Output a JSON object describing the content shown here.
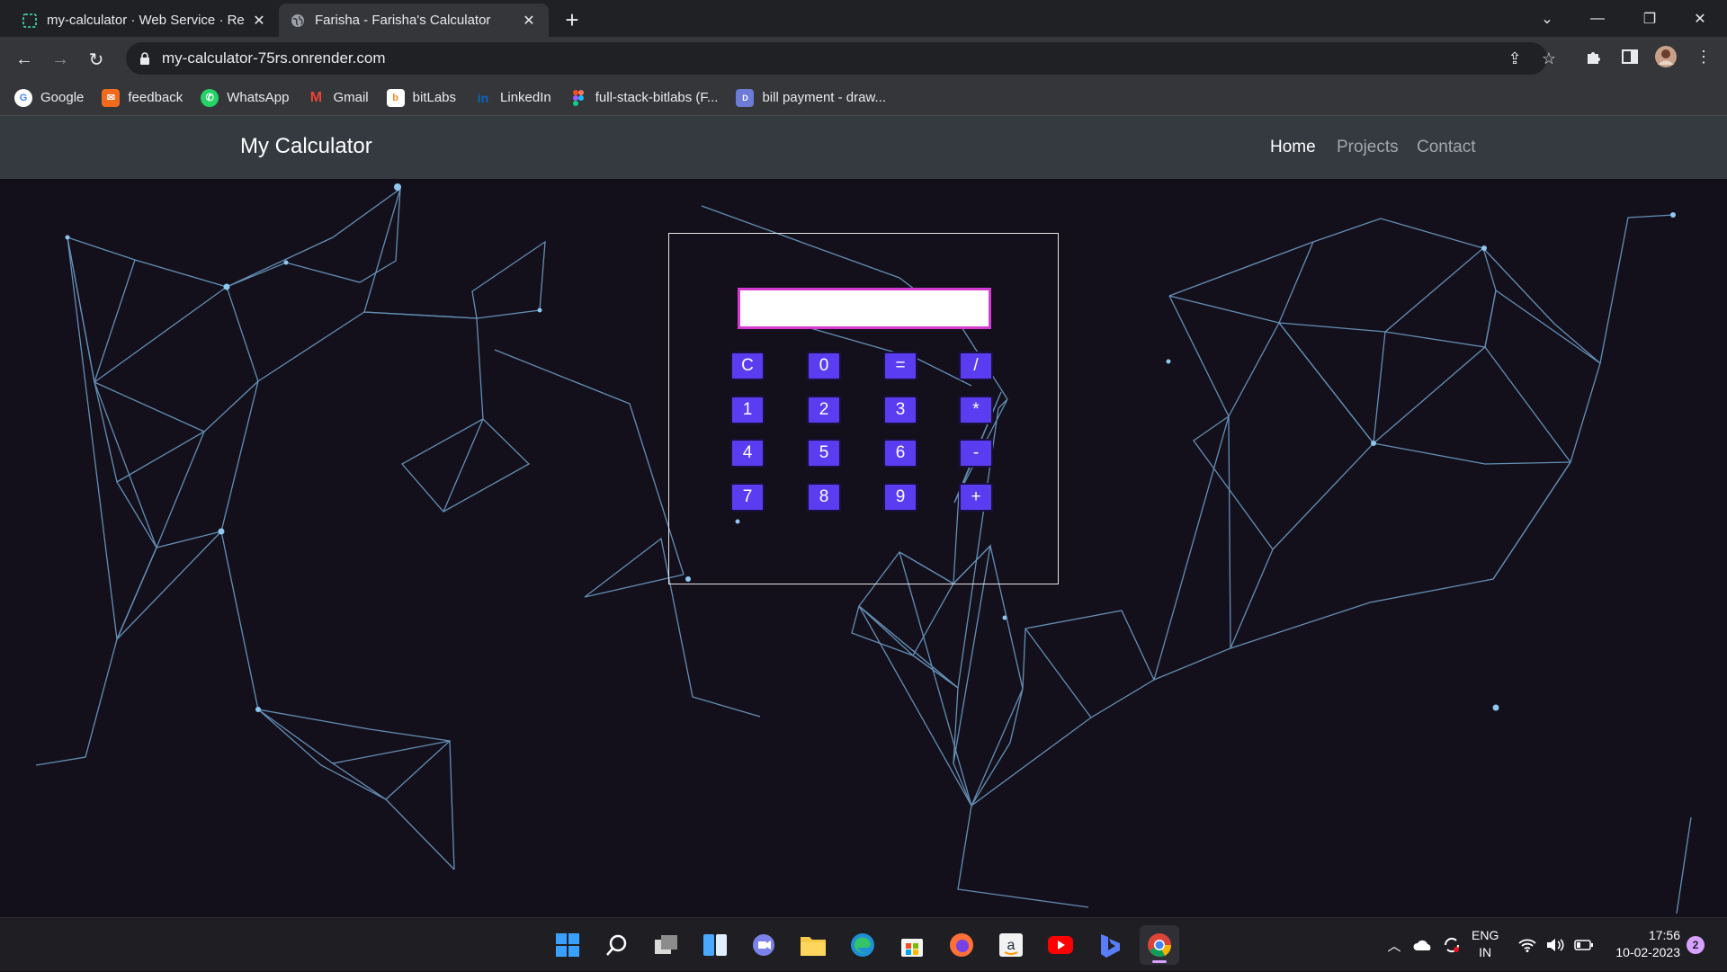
{
  "browser": {
    "tabs": [
      {
        "title": "my-calculator · Web Service · Re",
        "active": false
      },
      {
        "title": "Farisha - Farisha's Calculator",
        "active": true
      }
    ],
    "address": "my-calculator-75rs.onrender.com",
    "bookmarks": [
      {
        "label": "Google",
        "icon": "google-icon",
        "color": "#4285f4"
      },
      {
        "label": "feedback",
        "icon": "feedback-icon",
        "color": "#f26b1d"
      },
      {
        "label": "WhatsApp",
        "icon": "whatsapp-icon",
        "color": "#25d366"
      },
      {
        "label": "Gmail",
        "icon": "gmail-icon",
        "color": "#ea4335"
      },
      {
        "label": "bitLabs",
        "icon": "bitlabs-icon",
        "color": "#f08a24"
      },
      {
        "label": "LinkedIn",
        "icon": "linkedin-icon",
        "color": "#0a66c2"
      },
      {
        "label": "full-stack-bitlabs (F...",
        "icon": "figma-icon",
        "color": "#f24e1e"
      },
      {
        "label": "bill payment - draw...",
        "icon": "drawio-icon",
        "color": "#6b7bd6"
      }
    ]
  },
  "site": {
    "brand": "My Calculator",
    "nav": [
      {
        "label": "Home",
        "active": true
      },
      {
        "label": "Projects",
        "active": false
      },
      {
        "label": "Contact",
        "active": false
      }
    ]
  },
  "calculator": {
    "display_value": "",
    "keys": [
      [
        "C",
        "0",
        "=",
        "/"
      ],
      [
        "1",
        "2",
        "3",
        "*"
      ],
      [
        "4",
        "5",
        "6",
        "-"
      ],
      [
        "7",
        "8",
        "9",
        "+"
      ]
    ],
    "key_color": "#5a3df0",
    "display_border_color": "#d63bd1"
  },
  "taskbar": {
    "apps": [
      "windows-start-icon",
      "search-icon",
      "task-view-icon",
      "widgets-icon",
      "teams-chat-icon",
      "file-explorer-icon",
      "edge-icon",
      "microsoft-store-icon",
      "firefox-icon",
      "amazon-icon",
      "youtube-icon",
      "bing-icon",
      "chrome-icon"
    ],
    "language": "ENG",
    "region": "IN",
    "time": "17:56",
    "date": "10-02-2023",
    "notification_count": "2"
  }
}
